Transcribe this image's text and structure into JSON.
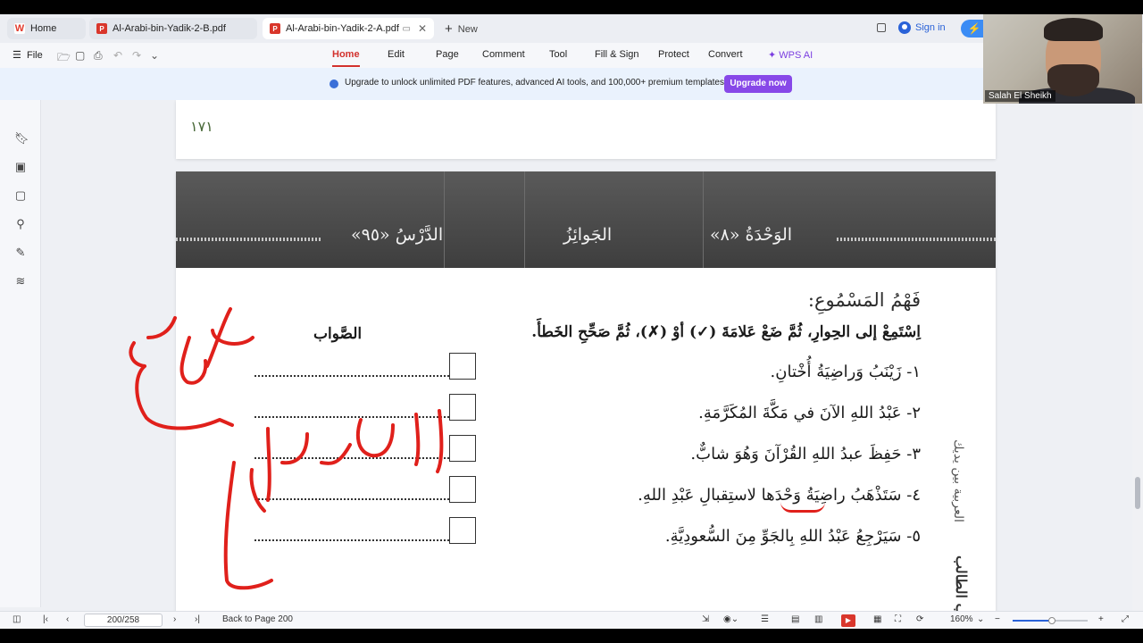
{
  "tabs": [
    {
      "label": "Home",
      "icon": "wps-logo-icon"
    },
    {
      "label": "Al-Arabi-bin-Yadik-2-B.pdf",
      "icon": "pdf-icon"
    },
    {
      "label": "Al-Arabi-bin-Yadik-2-A.pdf",
      "icon": "pdf-icon",
      "active": true
    }
  ],
  "new_tab": "New",
  "sign_in": "Sign in",
  "menu": {
    "file": "File",
    "items": [
      "Home",
      "Edit",
      "Page",
      "Comment",
      "Tool",
      "Fill & Sign",
      "Protect",
      "Convert"
    ],
    "ai": "WPS AI",
    "active": "Home"
  },
  "banner": {
    "text": "Upgrade to unlock unlimited PDF features, advanced AI tools, and 100,000+ premium templates.",
    "button": "Upgrade now"
  },
  "document": {
    "page_number_top": "١٧١",
    "header": {
      "unit": "الوَحْدَةُ  «٨»",
      "title": "الجَوائِزُ",
      "lesson": "الدَّرْسُ  «٩٥»"
    },
    "section_title": "فَهْمُ المَسْمُوعِ:",
    "instruction": "اِسْتَمِعْ إلى الحِوارِ، ثُمَّ ضَعْ عَلامَةَ (✓) أوْ (✗)، ثُمَّ صَحِّحِ الخَطأَ.",
    "correct_col": "الصَّواب",
    "questions": [
      "١- زَيْنَبُ وَراضِيَةُ أُخْتانِ.",
      "٢- عَبْدُ اللهِ الآنَ في مَكَّةَ المُكَرَّمَةِ.",
      "٣- حَفِظَ عبدُ اللهِ القُرْآنَ وَهُوَ شابٌّ.",
      "٤- سَتَذْهَبُ راضِيَةُ وَحْدَها لاستِقبالِ عَبْدِ اللهِ.",
      "٥- سَيَرْجِعُ عَبْدُ اللهِ بِالجَوِّ مِنَ السُّعودِيَّةِ."
    ],
    "side_text": "العربية بين يديك",
    "side_text_2": "كتاب الطالب"
  },
  "annotations": {
    "handwriting_1": "يوم",
    "handwriting_2": "استقبال",
    "ink_color": "#e0201b"
  },
  "status": {
    "page_input": "200/258",
    "back_to": "Back to Page 200",
    "zoom": "160%"
  },
  "webcam": {
    "name": "Salah El Sheikh"
  }
}
